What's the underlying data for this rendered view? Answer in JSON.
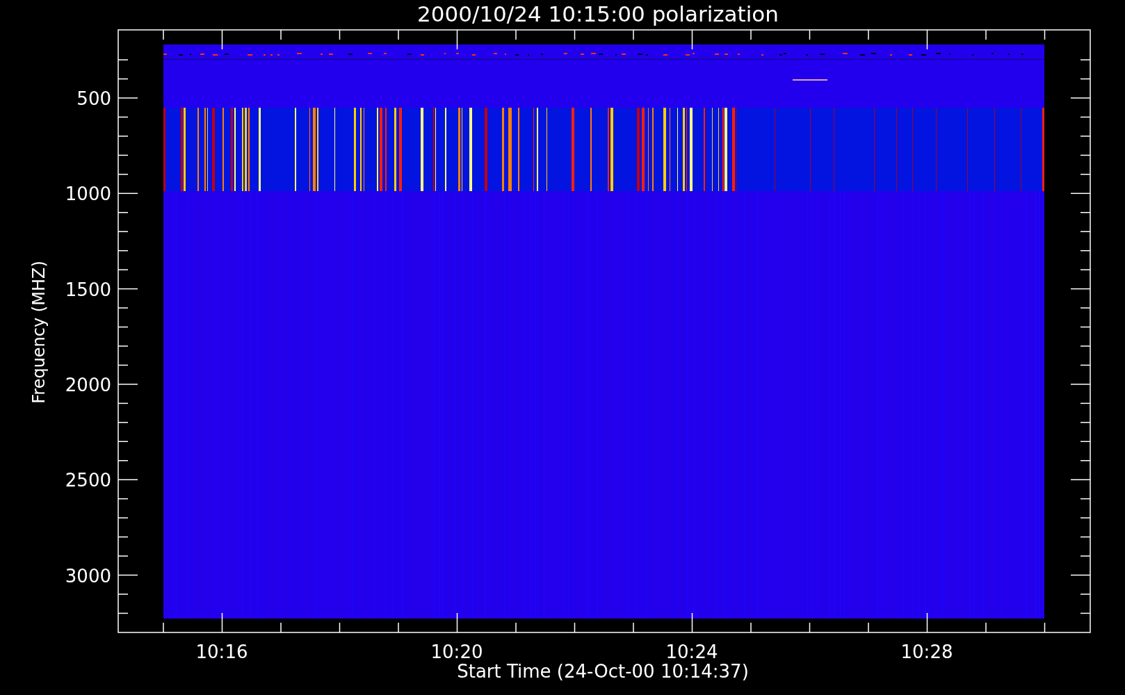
{
  "plot": {
    "title": "2000/10/24 10:15:00 polarization",
    "ylabel": "Frequency (MHZ)",
    "xlabel": "Start Time (24-Oct-00 10:14:37)",
    "yticks": [
      "500",
      "1000",
      "1500",
      "2000",
      "2500",
      "3000"
    ],
    "xticks": [
      "10:16",
      "10:20",
      "10:24",
      "10:28"
    ]
  }
}
